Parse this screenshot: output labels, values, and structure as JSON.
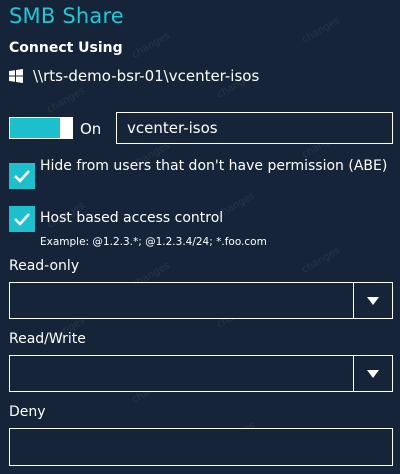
{
  "panel": {
    "title": "SMB Share",
    "connect_using_label": "Connect Using",
    "share_path": "\\\\rts-demo-bsr-01\\vcenter-isos",
    "share_icon": "windows-icon"
  },
  "share_toggle": {
    "state_label": "On",
    "is_on": true
  },
  "share_name": {
    "value": "vcenter-isos"
  },
  "options": {
    "abe": {
      "label": "Hide from users that don't have permission (ABE)",
      "checked": true
    },
    "host_access": {
      "label": "Host based access control",
      "checked": true,
      "example": "Example: @1.2.3.*; @1.2.3.4/24; *.foo.com"
    }
  },
  "fields": {
    "read_only": {
      "label": "Read-only",
      "value": ""
    },
    "read_write": {
      "label": "Read/Write",
      "value": ""
    },
    "deny": {
      "label": "Deny",
      "value": ""
    }
  },
  "watermark_text": "changes",
  "colors": {
    "background": "#152438",
    "accent": "#1ec9d6",
    "checkbox": "#1ebfcc",
    "text": "#ffffff"
  }
}
